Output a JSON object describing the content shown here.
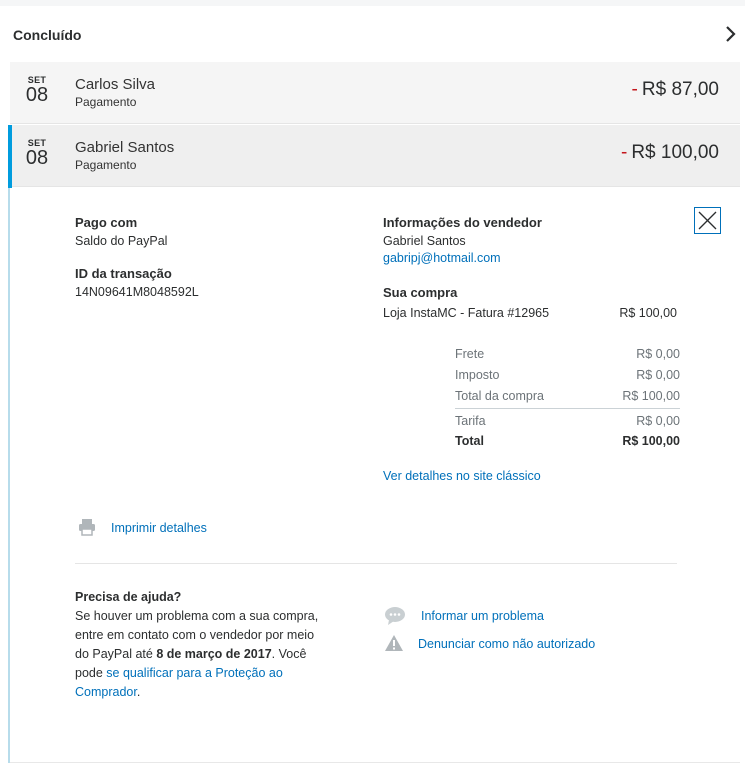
{
  "header": {
    "title": "Concluído"
  },
  "transactions": [
    {
      "month": "SET",
      "day": "08",
      "name": "Carlos Silva",
      "type": "Pagamento",
      "minus": "-",
      "amount": "R$ 87,00"
    },
    {
      "month": "SET",
      "day": "08",
      "name": "Gabriel Santos",
      "type": "Pagamento",
      "minus": "-",
      "amount": "R$ 100,00"
    }
  ],
  "detail": {
    "paid_with_label": "Pago com",
    "paid_with_value": "Saldo do PayPal",
    "txn_id_label": "ID da transação",
    "txn_id_value": "14N09641M8048592L",
    "seller_label": "Informações do vendedor",
    "seller_name": "Gabriel Santos",
    "seller_email": "gabripj@hotmail.com",
    "purchase_label": "Sua compra",
    "purchase_item": "Loja InstaMC - Fatura #12965",
    "purchase_amount": "R$ 100,00",
    "breakdown": [
      {
        "label": "Frete",
        "value": "R$ 0,00"
      },
      {
        "label": "Imposto",
        "value": "R$ 0,00"
      },
      {
        "label": "Total da compra",
        "value": "R$ 100,00"
      },
      {
        "label": "Tarifa",
        "value": "R$ 0,00"
      },
      {
        "label": "Total",
        "value": "R$ 100,00"
      }
    ],
    "classic_link": "Ver detalhes no site clássico",
    "print_link": "Imprimir detalhes",
    "help_title": "Precisa de ajuda?",
    "help_text_1": "Se houver um problema com a sua compra, entre em contato com o vendedor por meio do PayPal até ",
    "help_date": "8 de março de 2017",
    "help_text_2": ". Você pode ",
    "help_link": "se qualificar para a Proteção ao Comprador",
    "help_text_3": ".",
    "report_problem": "Informar um problema",
    "report_unauthorized": "Denunciar como não autorizado"
  },
  "colors": {
    "link": "#0070ba",
    "minus": "#c4161c",
    "active_bar": "#009cde"
  },
  "icons": [
    "chevron-right-icon",
    "close-icon",
    "printer-icon",
    "chat-bubble-icon",
    "warning-icon"
  ]
}
